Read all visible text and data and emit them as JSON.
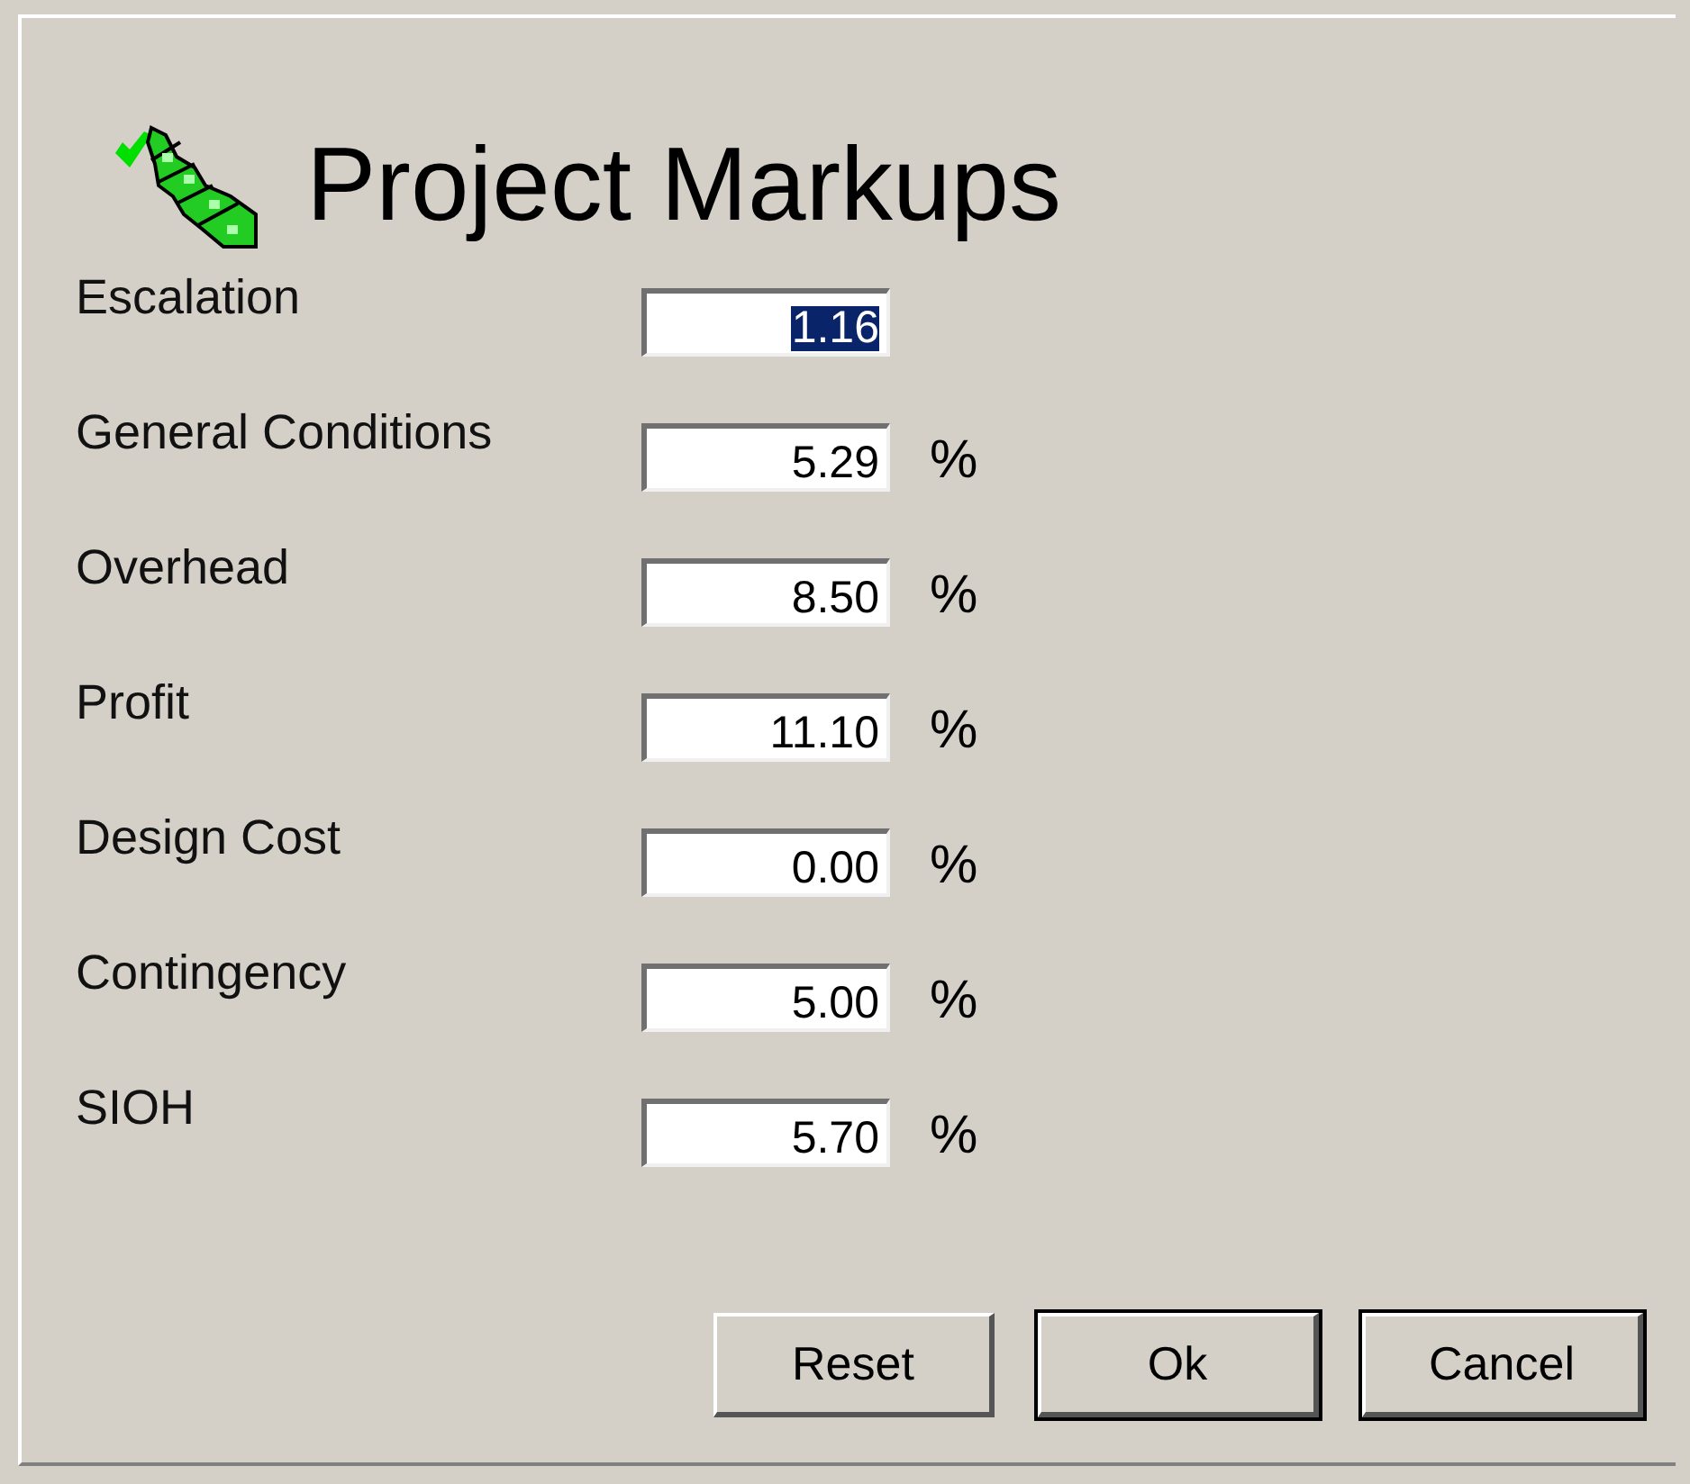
{
  "title": "Project Markups",
  "fields": [
    {
      "label": "Escalation",
      "value": "1.16",
      "selected": true
    },
    {
      "label": "General Conditions",
      "value": "5.29",
      "selected": false,
      "unit": "%"
    },
    {
      "label": "Overhead",
      "value": "8.50",
      "selected": false,
      "unit": "%"
    },
    {
      "label": "Profit",
      "value": "11.10",
      "selected": false,
      "unit": "%"
    },
    {
      "label": "Design Cost",
      "value": "0.00",
      "selected": false,
      "unit": "%"
    },
    {
      "label": "Contingency",
      "value": "5.00",
      "selected": false,
      "unit": "%"
    },
    {
      "label": "SIOH",
      "value": "5.70",
      "selected": false,
      "unit": "%"
    }
  ],
  "buttons": [
    {
      "label": "Reset",
      "framed": false
    },
    {
      "label": "Ok",
      "framed": true
    },
    {
      "label": "Cancel",
      "framed": true
    }
  ]
}
